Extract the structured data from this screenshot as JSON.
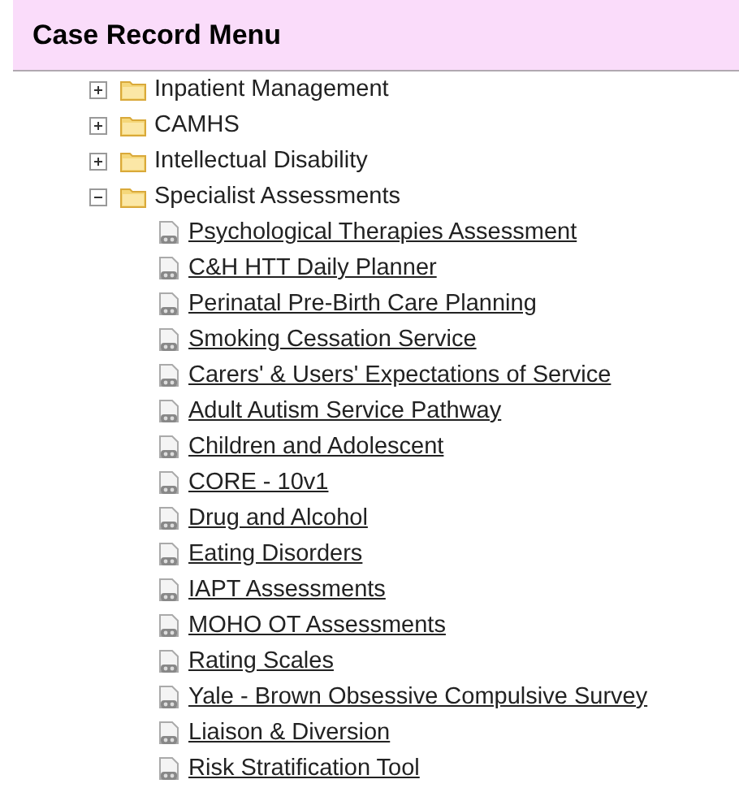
{
  "header": {
    "title": "Case Record Menu"
  },
  "tree": [
    {
      "label": "Inpatient Management",
      "expanded": false
    },
    {
      "label": "CAMHS",
      "expanded": false
    },
    {
      "label": "Intellectual Disability",
      "expanded": false
    },
    {
      "label": "Specialist Assessments",
      "expanded": true,
      "children": [
        {
          "label": "Psychological Therapies Assessment"
        },
        {
          "label": "C&H HTT Daily Planner"
        },
        {
          "label": "Perinatal Pre-Birth Care Planning"
        },
        {
          "label": "Smoking Cessation Service"
        },
        {
          "label": "Carers' & Users' Expectations of Service"
        },
        {
          "label": "Adult Autism Service Pathway"
        },
        {
          "label": "Children and Adolescent"
        },
        {
          "label": "CORE - 10v1"
        },
        {
          "label": "Drug and Alcohol"
        },
        {
          "label": "Eating Disorders"
        },
        {
          "label": "IAPT Assessments"
        },
        {
          "label": "MOHO OT Assessments"
        },
        {
          "label": "Rating Scales"
        },
        {
          "label": "Yale - Brown Obsessive Compulsive Survey"
        },
        {
          "label": "Liaison & Diversion"
        },
        {
          "label": "Risk Stratification Tool"
        }
      ]
    }
  ]
}
